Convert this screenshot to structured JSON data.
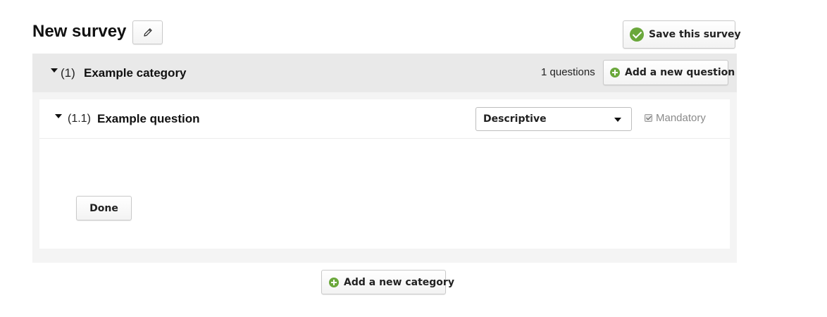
{
  "survey": {
    "title": "New survey",
    "save_label": "Save this survey"
  },
  "category": {
    "number": "(1)",
    "name": "Example category",
    "questions_count": "1 questions",
    "add_question_label": "Add a new question"
  },
  "question": {
    "number": "(1.1)",
    "name": "Example question",
    "type_selected": "Descriptive",
    "mandatory_label": "Mandatory",
    "mandatory_checked": true,
    "done_label": "Done"
  },
  "add_category_label": "Add a new category",
  "colors": {
    "accent_green": "#6aa73b",
    "category_header_bg": "#e9e9e9",
    "category_body_bg": "#f4f4f4"
  },
  "icons": {
    "edit": "pencil-icon",
    "save": "check-circle-icon",
    "add": "plus-circle-icon",
    "collapse": "caret-down-icon"
  }
}
